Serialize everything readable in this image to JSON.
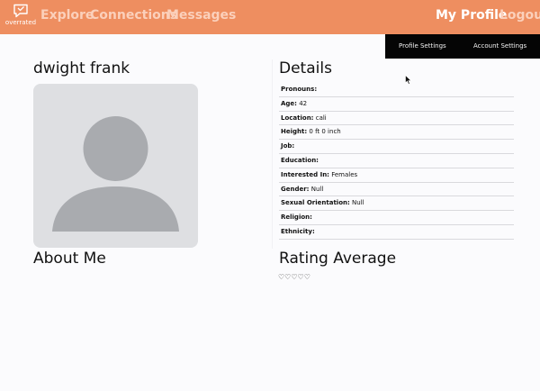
{
  "navbar": {
    "logo_text": "overrated",
    "links": [
      "Explore",
      "Connections",
      "Messages"
    ],
    "my_profile": "My Profile",
    "logout": "Logout",
    "color": "#ee8e60"
  },
  "settings_menu": {
    "items": [
      "Profile Settings",
      "Account Settings"
    ]
  },
  "profile": {
    "name": "dwight frank",
    "avatar": "default-user-avatar"
  },
  "details": {
    "heading": "Details",
    "rows": [
      {
        "label": "Pronouns:",
        "value": ""
      },
      {
        "label": "Age:",
        "value": "42"
      },
      {
        "label": "Location:",
        "value": "cali"
      },
      {
        "label": "Height:",
        "value": "0 ft 0 inch"
      },
      {
        "label": "Job:",
        "value": ""
      },
      {
        "label": "Education:",
        "value": ""
      },
      {
        "label": "Interested In:",
        "value": "Females"
      },
      {
        "label": "Gender:",
        "value": "Null"
      },
      {
        "label": "Sexual Orientation:",
        "value": "Null"
      },
      {
        "label": "Religion:",
        "value": ""
      },
      {
        "label": "Ethnicity:",
        "value": ""
      }
    ]
  },
  "about": {
    "heading": "About Me"
  },
  "rating": {
    "heading": "Rating Average",
    "stars": "♡♡♡♡♡",
    "filled": 0,
    "max": 5
  }
}
